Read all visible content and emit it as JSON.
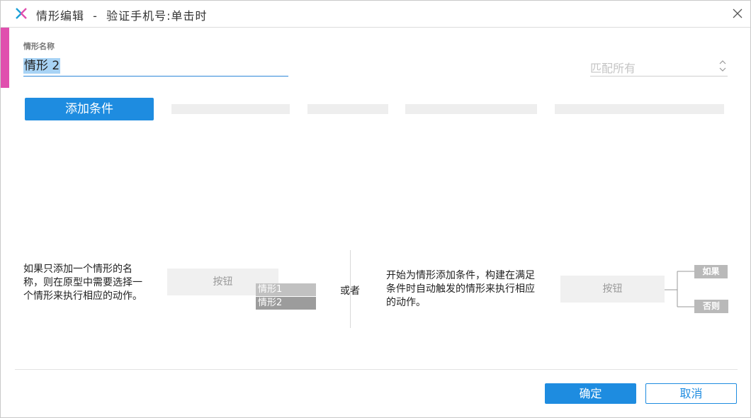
{
  "window": {
    "title": "情形编辑  -  验证手机号:单击时",
    "accent_color": "#e04fae",
    "primary_color": "#1e8ce0"
  },
  "case_name": {
    "label": "情形名称",
    "value": "情形 2"
  },
  "match": {
    "selected": "匹配所有"
  },
  "add_condition": {
    "label": "添加条件"
  },
  "help": {
    "left_text": "如果只添加一个情形的名称，则在原型中需要选择一个情形来执行相应的动作。",
    "left_demo_button": "按钮",
    "left_case_options": [
      "情形1",
      "情形2"
    ],
    "or_text": "或者",
    "right_text": "开始为情形添加条件，构建在满足条件时自动触发的情形来执行相应的动作。",
    "right_demo_button": "按钮",
    "if_tag": "如果",
    "else_tag": "否则"
  },
  "footer": {
    "ok_label": "确定",
    "cancel_label": "取消"
  },
  "icons": [
    "app-logo-icon",
    "close-icon",
    "chevron-updown-icon"
  ]
}
